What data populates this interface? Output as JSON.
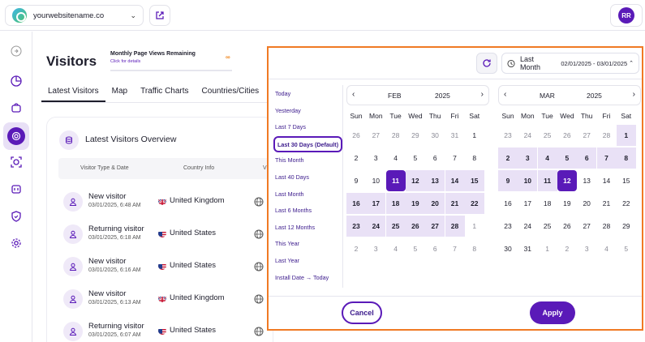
{
  "topbar": {
    "site_name": "yourwebsitename.co",
    "avatar_initials": "RR"
  },
  "header": {
    "title": "Visitors",
    "quota_title": "Monthly Page Views Remaining",
    "quota_link": "Click for details",
    "quota_value": "∞"
  },
  "tabs": [
    "Latest Visitors",
    "Map",
    "Traffic Charts",
    "Countries/Cities",
    "V"
  ],
  "overview": {
    "title": "Latest Visitors Overview",
    "columns": [
      "Visitor Type & Date",
      "Country Info",
      "V"
    ],
    "rows": [
      {
        "type": "New visitor",
        "date": "03/01/2025, 6:48 AM",
        "country": "United Kingdom",
        "flag": "uk"
      },
      {
        "type": "Returning visitor",
        "date": "03/01/2025, 6:18 AM",
        "country": "United States",
        "flag": "us"
      },
      {
        "type": "New visitor",
        "date": "03/01/2025, 6:16 AM",
        "country": "United States",
        "flag": "us"
      },
      {
        "type": "New visitor",
        "date": "03/01/2025, 6:13 AM",
        "country": "United Kingdom",
        "flag": "uk"
      },
      {
        "type": "Returning visitor",
        "date": "03/01/2025, 6:07 AM",
        "country": "United States",
        "flag": "us"
      }
    ]
  },
  "datepicker": {
    "range_label": "Last Month",
    "range_value": "02/01/2025 - 03/01/2025",
    "presets": [
      "Today",
      "Yesterday",
      "Last 7 Days",
      "Last 30 Days (Default)",
      "This Month",
      "Last 40 Days",
      "Last Month",
      "Last 6 Months",
      "Last 12 Months",
      "This Year",
      "Last Year",
      "Install Date → Today"
    ],
    "selected_preset": "Last 30 Days (Default)",
    "weekdays": [
      "Sun",
      "Mon",
      "Tue",
      "Wed",
      "Thu",
      "Fri",
      "Sat"
    ],
    "calendars": [
      {
        "month": "FEB",
        "year": "2025",
        "weeks": [
          [
            [
              "26",
              "m"
            ],
            [
              "27",
              "m"
            ],
            [
              "28",
              "m"
            ],
            [
              "29",
              "m"
            ],
            [
              "30",
              "m"
            ],
            [
              "31",
              "m"
            ],
            [
              "1",
              "p"
            ]
          ],
          [
            [
              "2",
              "p"
            ],
            [
              "3",
              "p"
            ],
            [
              "4",
              "p"
            ],
            [
              "5",
              "p"
            ],
            [
              "6",
              "p"
            ],
            [
              "7",
              "p"
            ],
            [
              "8",
              "p"
            ]
          ],
          [
            [
              "9",
              "p"
            ],
            [
              "10",
              "p"
            ],
            [
              "11",
              "s"
            ],
            [
              "12",
              "r"
            ],
            [
              "13",
              "r"
            ],
            [
              "14",
              "r"
            ],
            [
              "15",
              "r"
            ]
          ],
          [
            [
              "16",
              "r"
            ],
            [
              "17",
              "r"
            ],
            [
              "18",
              "r"
            ],
            [
              "19",
              "r"
            ],
            [
              "20",
              "r"
            ],
            [
              "21",
              "r"
            ],
            [
              "22",
              "r"
            ]
          ],
          [
            [
              "23",
              "r"
            ],
            [
              "24",
              "r"
            ],
            [
              "25",
              "r"
            ],
            [
              "26",
              "r"
            ],
            [
              "27",
              "r"
            ],
            [
              "28",
              "r"
            ],
            [
              "1",
              "m"
            ]
          ],
          [
            [
              "2",
              "m"
            ],
            [
              "3",
              "m"
            ],
            [
              "4",
              "m"
            ],
            [
              "5",
              "m"
            ],
            [
              "6",
              "m"
            ],
            [
              "7",
              "m"
            ],
            [
              "8",
              "m"
            ]
          ]
        ]
      },
      {
        "month": "MAR",
        "year": "2025",
        "weeks": [
          [
            [
              "23",
              "m"
            ],
            [
              "24",
              "m"
            ],
            [
              "25",
              "m"
            ],
            [
              "26",
              "m"
            ],
            [
              "27",
              "m"
            ],
            [
              "28",
              "m"
            ],
            [
              "1",
              "r"
            ]
          ],
          [
            [
              "2",
              "r"
            ],
            [
              "3",
              "r"
            ],
            [
              "4",
              "r"
            ],
            [
              "5",
              "r"
            ],
            [
              "6",
              "r"
            ],
            [
              "7",
              "r"
            ],
            [
              "8",
              "r"
            ]
          ],
          [
            [
              "9",
              "r"
            ],
            [
              "10",
              "r"
            ],
            [
              "11",
              "r"
            ],
            [
              "12",
              "s"
            ],
            [
              "13",
              "p"
            ],
            [
              "14",
              "p"
            ],
            [
              "15",
              "p"
            ]
          ],
          [
            [
              "16",
              "p"
            ],
            [
              "17",
              "p"
            ],
            [
              "18",
              "p"
            ],
            [
              "19",
              "p"
            ],
            [
              "20",
              "p"
            ],
            [
              "21",
              "p"
            ],
            [
              "22",
              "p"
            ]
          ],
          [
            [
              "23",
              "p"
            ],
            [
              "24",
              "p"
            ],
            [
              "25",
              "p"
            ],
            [
              "26",
              "p"
            ],
            [
              "27",
              "p"
            ],
            [
              "28",
              "p"
            ],
            [
              "29",
              "p"
            ]
          ],
          [
            [
              "30",
              "p"
            ],
            [
              "31",
              "p"
            ],
            [
              "1",
              "m"
            ],
            [
              "2",
              "m"
            ],
            [
              "3",
              "m"
            ],
            [
              "4",
              "m"
            ],
            [
              "5",
              "m"
            ]
          ]
        ]
      }
    ],
    "cancel_label": "Cancel",
    "apply_label": "Apply"
  },
  "colors": {
    "accent": "#5a1ab8",
    "range_fill": "#e9e1f6",
    "highlight_border": "#f07a24"
  }
}
